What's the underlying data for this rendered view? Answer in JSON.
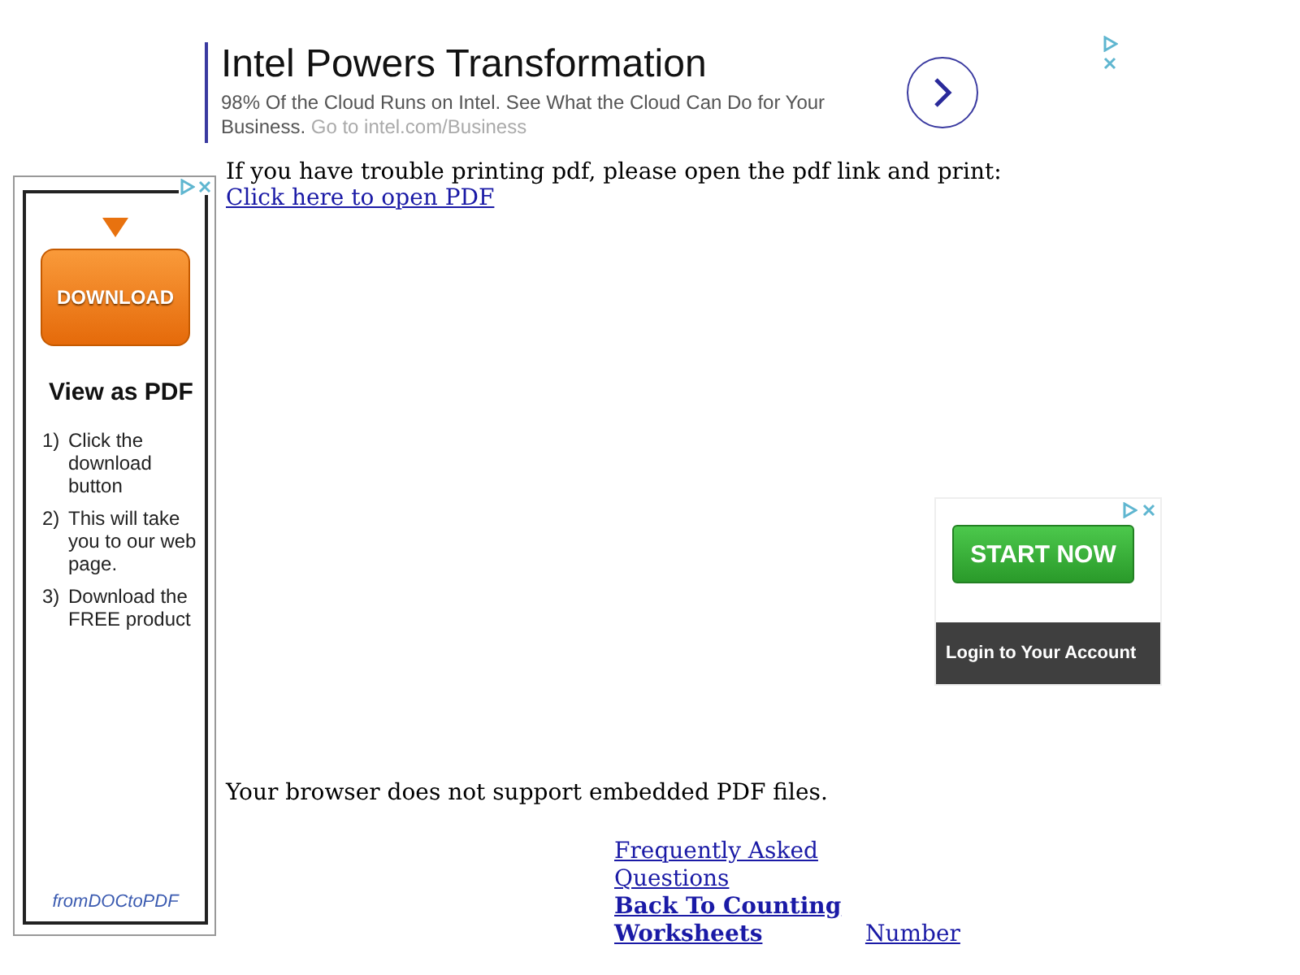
{
  "top_ad": {
    "headline": "Intel Powers Transformation",
    "body": "98% Of the Cloud Runs on Intel. See What the Cloud Can Do for Your Business.",
    "link": "Go to intel.com/Business"
  },
  "left_ad": {
    "button": "DOWNLOAD",
    "title": "View as PDF",
    "steps": [
      {
        "number": "1)",
        "text": "Click the download button"
      },
      {
        "number": "2)",
        "text": "This will take you to our web page."
      },
      {
        "number": "3)",
        "text": "Download the FREE product"
      }
    ],
    "brand": "fromDOCtoPDF"
  },
  "notice": {
    "text": "If you have trouble printing pdf, please open the pdf link and print:",
    "link": "Click here to open PDF"
  },
  "right_ad": {
    "button": "START NOW",
    "footer": "Login to Your Account"
  },
  "fallback_text": "Your browser does not support embedded PDF files.",
  "links": [
    {
      "text": "Frequently Asked Questions",
      "bold": false
    },
    {
      "text": "Back To Counting Worksheets",
      "bold": true
    },
    {
      "text": "Number",
      "bold": false
    }
  ]
}
